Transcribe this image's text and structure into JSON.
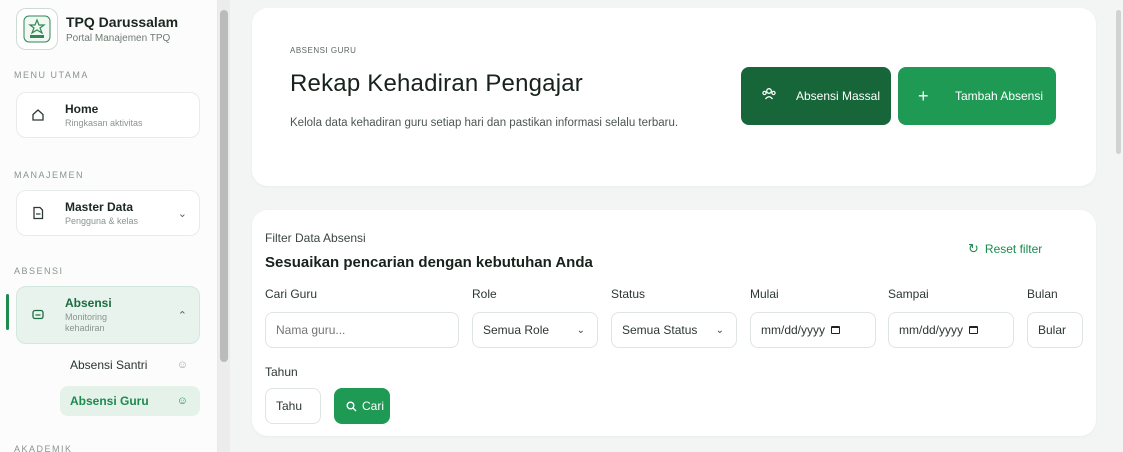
{
  "brand": {
    "title": "TPQ Darussalam",
    "subtitle": "Portal Manajemen TPQ"
  },
  "sidebar": {
    "sections": {
      "menu_utama": "MENU UTAMA",
      "manajemen": "MANAJEMEN",
      "absensi": "ABSENSI",
      "akademik": "AKADEMIK"
    },
    "home": {
      "title": "Home",
      "subtitle": "Ringkasan aktivitas"
    },
    "master_data": {
      "title": "Master Data",
      "subtitle": "Pengguna & kelas"
    },
    "absensi": {
      "title": "Absensi",
      "subtitle": "Monitoring kehadiran"
    },
    "sub_items": [
      {
        "label": "Absensi Santri"
      },
      {
        "label": "Absensi Guru"
      }
    ]
  },
  "hero": {
    "eyebrow": "ABSENSI GURU",
    "title": "Rekap Kehadiran Pengajar",
    "description": "Kelola data kehadiran guru setiap hari dan pastikan informasi selalu terbaru.",
    "buttons": {
      "absensi_massal": "Absensi Massal",
      "tambah_absensi": "Tambah Absensi"
    }
  },
  "filter": {
    "eyebrow": "Filter Data Absensi",
    "title": "Sesuaikan pencarian dengan kebutuhan Anda",
    "reset_label": "Reset filter",
    "fields": {
      "cari_guru": {
        "label": "Cari Guru",
        "placeholder": "Nama guru..."
      },
      "role": {
        "label": "Role",
        "value": "Semua Role"
      },
      "status": {
        "label": "Status",
        "value": "Semua Status"
      },
      "mulai": {
        "label": "Mulai",
        "value": "mm/dd/yyyy"
      },
      "sampai": {
        "label": "Sampai",
        "value": "mm/dd/yyyy"
      },
      "bulan": {
        "label": "Bulan",
        "value": "Bular"
      },
      "tahun": {
        "label": "Tahun",
        "value": "Tahu"
      }
    },
    "cari_label": "Cari"
  },
  "colors": {
    "primary": "#1f9a55",
    "primary_dark": "#17663a",
    "active_bg": "#e8f3ed"
  }
}
